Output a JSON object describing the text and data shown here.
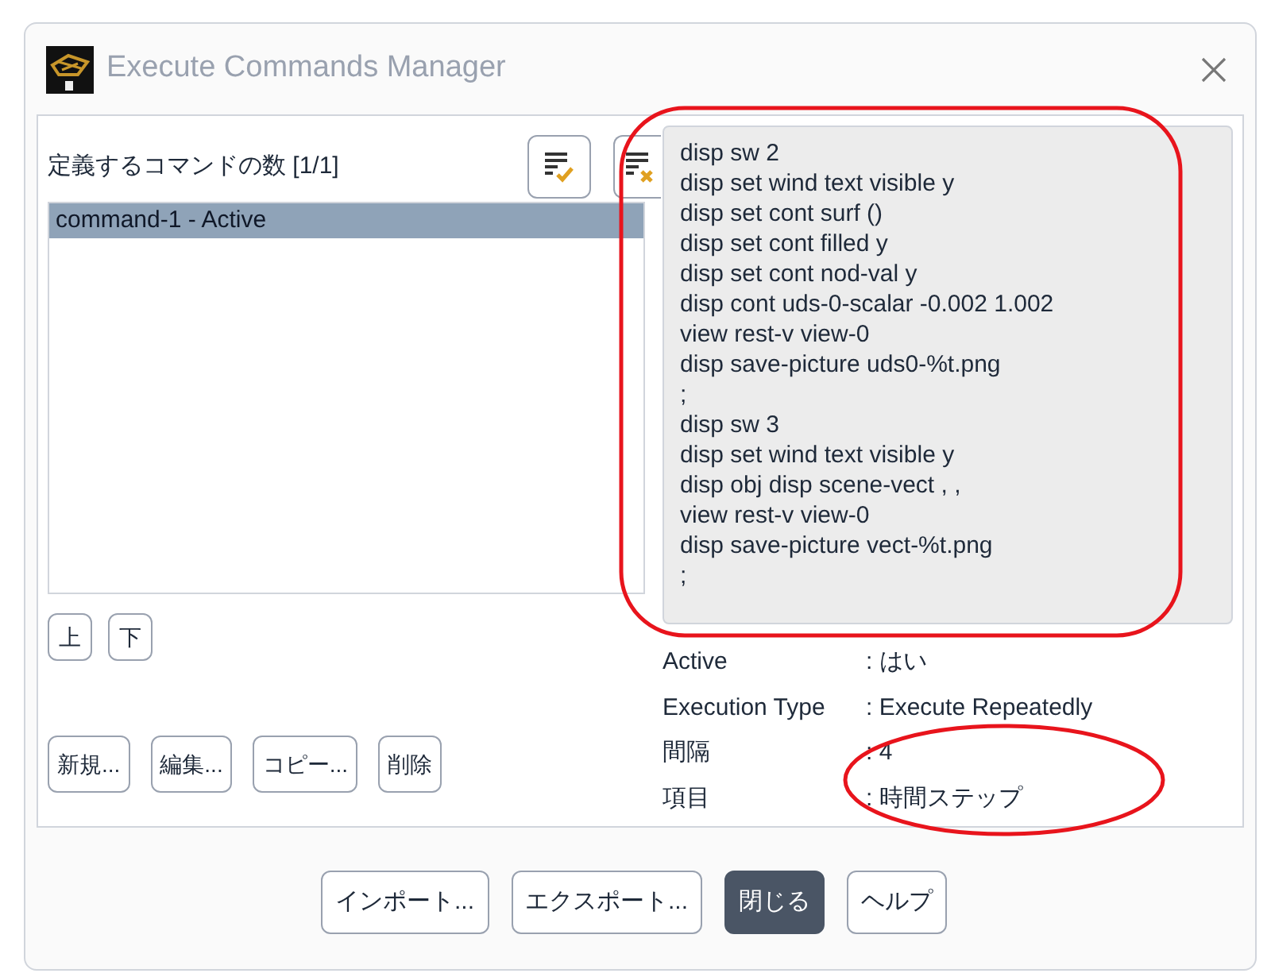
{
  "window": {
    "title": "Execute Commands Manager"
  },
  "list_header": "定義するコマンドの数 [1/1]",
  "commands": [
    {
      "label": "command-1 - Active",
      "selected": true
    }
  ],
  "move_buttons": [
    "上",
    "下"
  ],
  "action_buttons": [
    "新規...",
    "編集...",
    "コピー...",
    "削除"
  ],
  "command_text": [
    "disp sw 2",
    "disp set wind text visible y",
    "disp set cont surf ()",
    "disp set cont filled y",
    "disp set cont nod-val y",
    "disp cont uds-0-scalar -0.002 1.002",
    "view rest-v view-0",
    "disp save-picture uds0-%t.png",
    ";",
    "disp sw 3",
    "disp set wind text visible y",
    "disp obj disp scene-vect , ,",
    "view rest-v view-0",
    "disp save-picture vect-%t.png",
    ";"
  ],
  "details": [
    {
      "label": "Active",
      "value": ": はい"
    },
    {
      "label": "Execution Type",
      "value": ": Execute Repeatedly"
    },
    {
      "label": "間隔",
      "value": ": 4"
    },
    {
      "label": "項目",
      "value": ": 時間ステップ"
    }
  ],
  "footer_buttons": [
    {
      "label": "インポート...",
      "primary": false
    },
    {
      "label": "エクスポート...",
      "primary": false
    },
    {
      "label": "閉じる",
      "primary": true
    },
    {
      "label": "ヘルプ",
      "primary": false
    }
  ]
}
